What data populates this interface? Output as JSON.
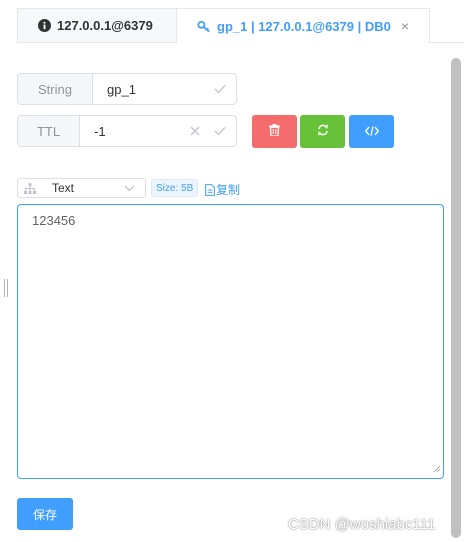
{
  "tabs": [
    {
      "label": "127.0.0.1@6379",
      "icon": "info-icon",
      "active": false
    },
    {
      "label": "gp_1 | 127.0.0.1@6379 | DB0",
      "icon": "key-icon",
      "active": true,
      "close": "×"
    }
  ],
  "key_row": {
    "type_label": "String",
    "key_value": "gp_1"
  },
  "ttl_row": {
    "label": "TTL",
    "value": "-1"
  },
  "actions": [
    {
      "name": "delete",
      "icon": "trash-icon",
      "color": "#f56c6c"
    },
    {
      "name": "refresh",
      "icon": "refresh-icon",
      "color": "#67c23a"
    },
    {
      "name": "code",
      "icon": "code-icon",
      "color": "#409eff"
    }
  ],
  "format": {
    "selected": "Text"
  },
  "size_tag": "Size: 5B",
  "copy_label": "复制",
  "value_content": "123456",
  "save_label": "保存",
  "watermark": "CSDN @woshiabc111",
  "colors": {
    "primary": "#409eff",
    "danger": "#f56c6c",
    "success": "#67c23a"
  }
}
